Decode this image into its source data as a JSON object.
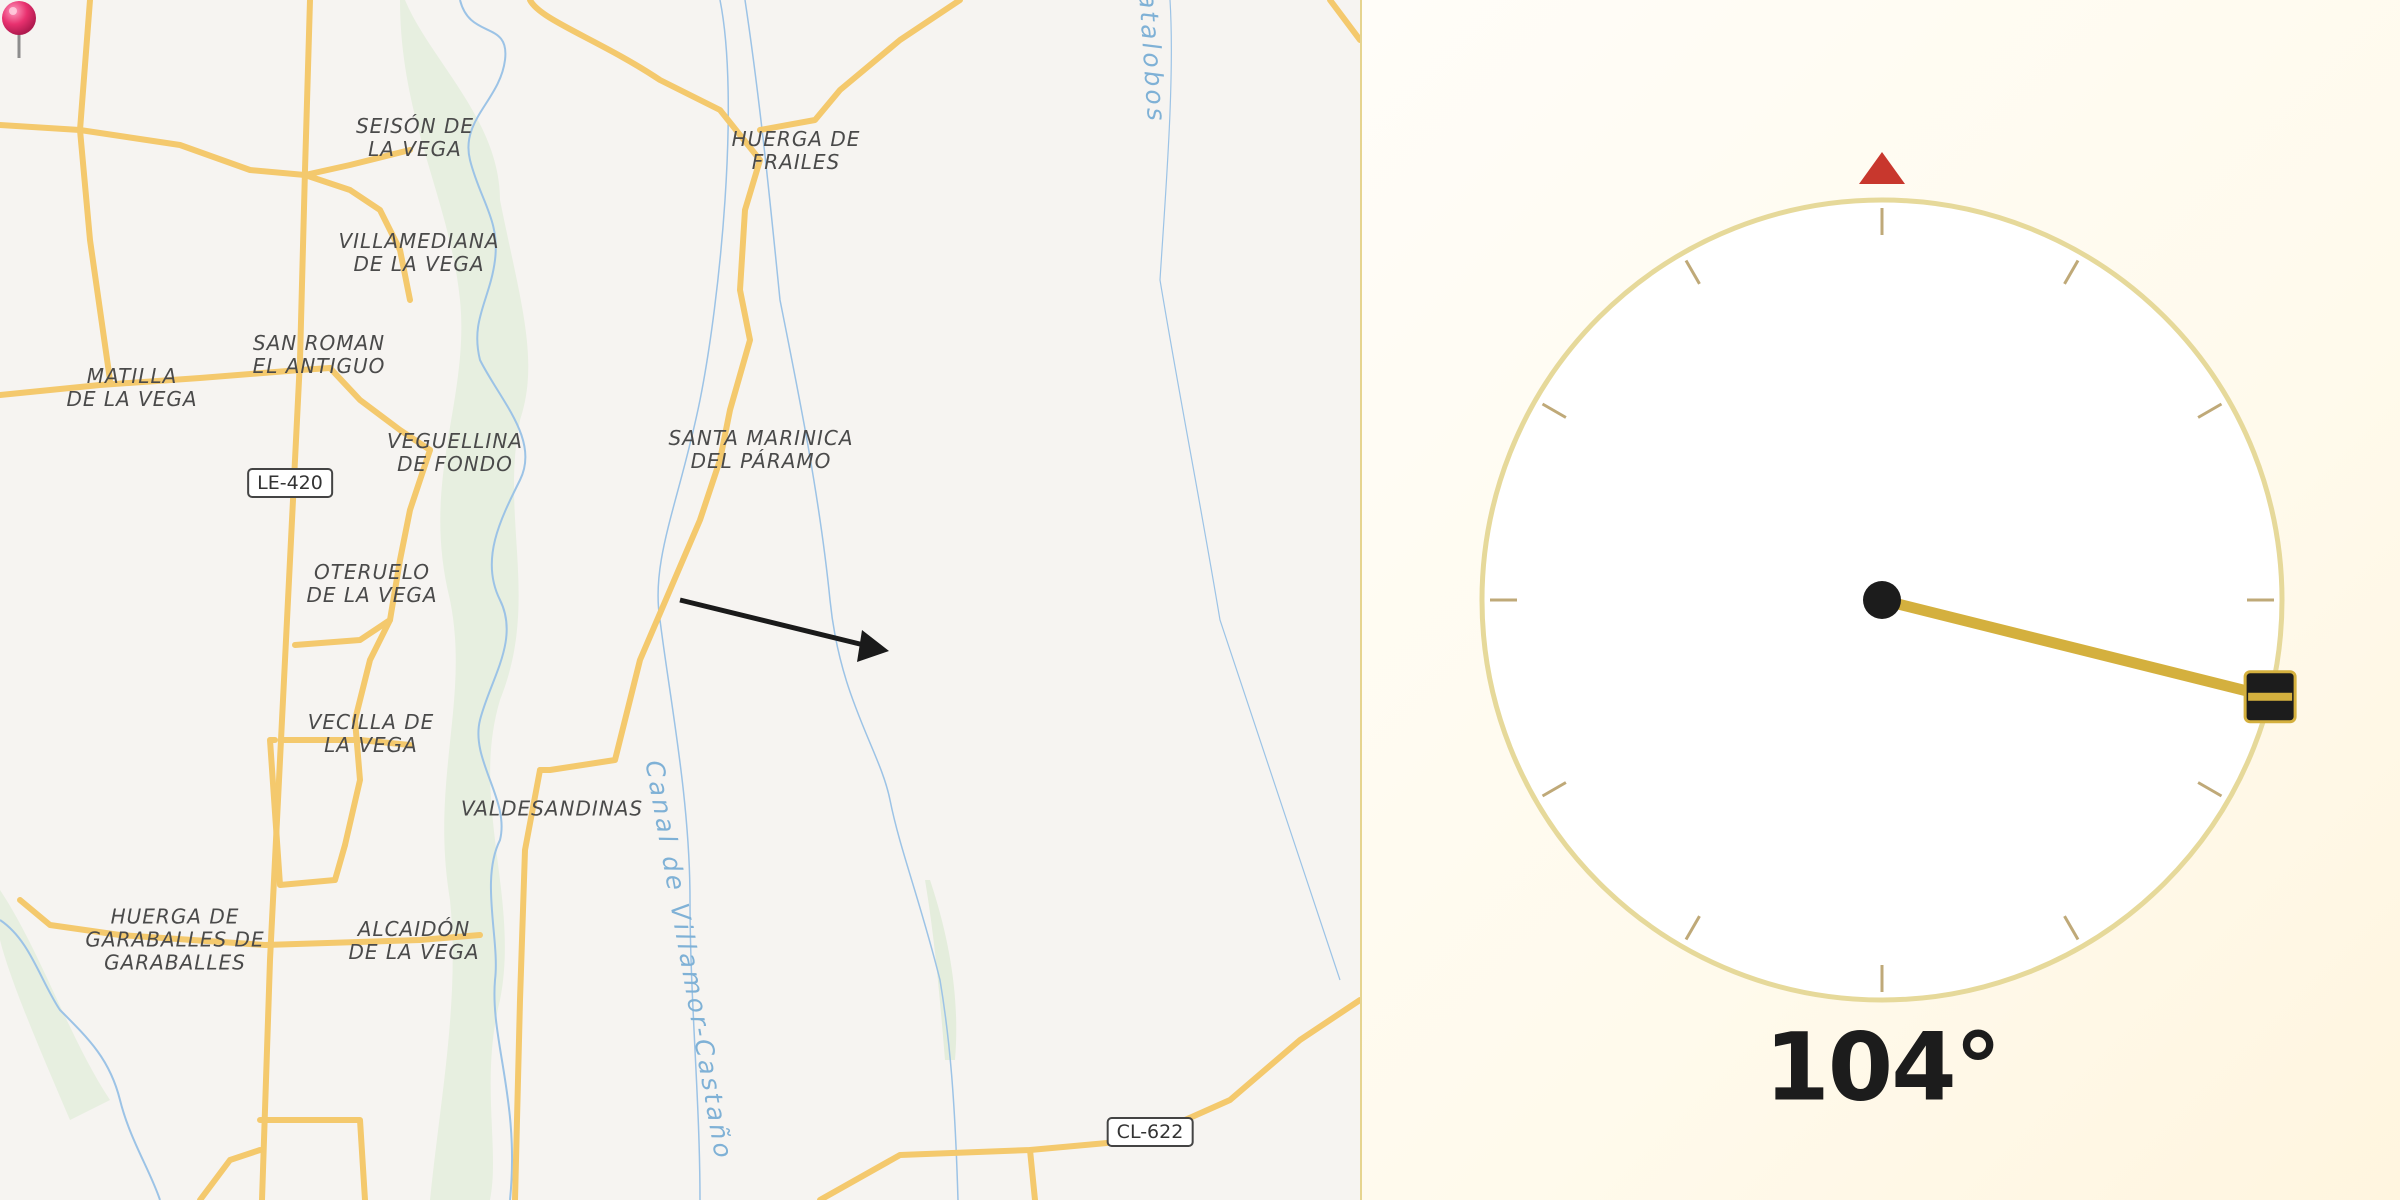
{
  "map": {
    "places": [
      {
        "id": "seison",
        "label": "Seisón de\nla Vega"
      },
      {
        "id": "huerga-frailes",
        "label": "Huerga de\nFrailes"
      },
      {
        "id": "villamediana",
        "label": "Villamediana\nde la Vega"
      },
      {
        "id": "san-roman",
        "label": "San Roman\nel Antiguo"
      },
      {
        "id": "matilla",
        "label": "Matilla\nde la Vega"
      },
      {
        "id": "santa-marinica",
        "label": "Santa Marinica\ndel Páramo"
      },
      {
        "id": "veguellina",
        "label": "Veguellina\nde Fondo"
      },
      {
        "id": "oteruelo",
        "label": "Oteruelo\nde la Vega"
      },
      {
        "id": "vecilla",
        "label": "Vecilla de\nla Vega"
      },
      {
        "id": "valdesandinas",
        "label": "Valdesandinas"
      },
      {
        "id": "huerga-garaballes",
        "label": "Huerga de\nGaraballes de\nGaraballes"
      },
      {
        "id": "alcaidon",
        "label": "Alcaidón\nde la Vega"
      }
    ],
    "roads": [
      {
        "id": "le420",
        "label": "LE-420"
      },
      {
        "id": "cl622",
        "label": "CL-622"
      }
    ],
    "water_labels": [
      {
        "id": "canal",
        "label": "Canal de Villamor-Castaño"
      },
      {
        "id": "atalobos",
        "label": "atalobos"
      }
    ]
  },
  "compass": {
    "heading_deg": 104,
    "heading_text": "104°",
    "north_marker_color": "#c8372d",
    "needle_color": "#d4b03e",
    "ring_color": "#e6d99a"
  }
}
